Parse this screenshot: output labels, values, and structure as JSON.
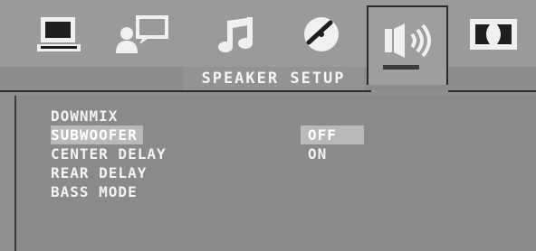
{
  "tabs": [
    {
      "name": "general-setup",
      "icon": "monitor-icon",
      "active": false
    },
    {
      "name": "language-setup",
      "icon": "person-speech-icon",
      "active": false
    },
    {
      "name": "audio-setup",
      "icon": "music-note-icon",
      "active": false
    },
    {
      "name": "video-setup",
      "icon": "disc-icon",
      "active": false
    },
    {
      "name": "speaker-setup",
      "icon": "speaker-icon",
      "active": true
    },
    {
      "name": "dolby-setup",
      "icon": "dolby-icon",
      "active": false
    }
  ],
  "page_title": "SPEAKER SETUP",
  "menu": {
    "items": [
      {
        "label": "DOWNMIX"
      },
      {
        "label": "SUBWOOFER",
        "selected": true
      },
      {
        "label": "CENTER DELAY"
      },
      {
        "label": "REAR DELAY"
      },
      {
        "label": "BASS MODE"
      }
    ]
  },
  "options": {
    "items": [
      {
        "label": "OFF",
        "selected": true
      },
      {
        "label": "ON"
      }
    ]
  },
  "colors": {
    "background": "#8f8f8f",
    "highlight": "#b9b9b9",
    "text": "#f3f3f3",
    "border": "#2b2b2b"
  }
}
